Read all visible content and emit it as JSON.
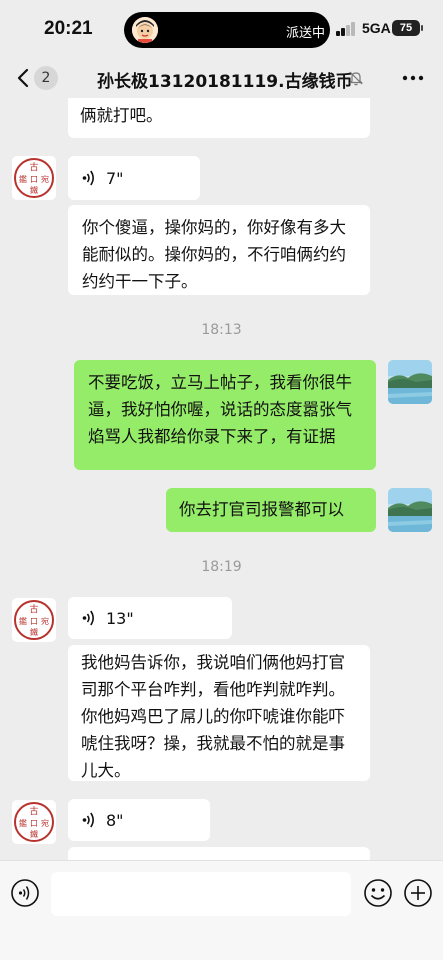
{
  "status_bar": {
    "time": "20:21",
    "island_label": "派送中",
    "network": "5GA",
    "battery": "75"
  },
  "nav": {
    "unread_count": "2",
    "title": "孙长极13120181119.古缘钱币"
  },
  "avatar_glyphs": {
    "top": "古",
    "left": "鑑",
    "center": "口",
    "right": "宛",
    "bottom": "鐵"
  },
  "messages": {
    "m1_partial": "俩就打吧。",
    "m2_voice_duration": "7\"",
    "m3_text": "你个傻逼，操你妈的，你好像有多大能耐似的。操你妈的，不行咱俩约约约约干一下子。",
    "time1": "18:13",
    "m4_text": "不要吃饭，立马上帖子，我看你很牛逼，我好怕你喔，说话的态度嚣张气焰骂人我都给你录下来了，有证据",
    "m5_text": "你去打官司报警都可以",
    "time2": "18:19",
    "m6_voice_duration": "13\"",
    "m7_text": "我他妈告诉你，我说咱们俩他妈打官司那个平台咋判，看他咋判就咋判。你他妈鸡巴了屌儿的你吓唬谁你能吓唬住我呀？操，我就最不怕的就是事儿大。",
    "m8_voice_duration": "8\""
  },
  "colors": {
    "background": "#ededed",
    "outgoing_bubble": "#95ec69",
    "incoming_bubble": "#ffffff",
    "seal_red": "#b8322d"
  },
  "icons": {
    "back": "chevron-left-icon",
    "mute": "bell-off-icon",
    "more": "more-dots-icon",
    "voice_mode": "voice-mode-icon",
    "emoji": "emoji-icon",
    "add": "plus-icon"
  }
}
